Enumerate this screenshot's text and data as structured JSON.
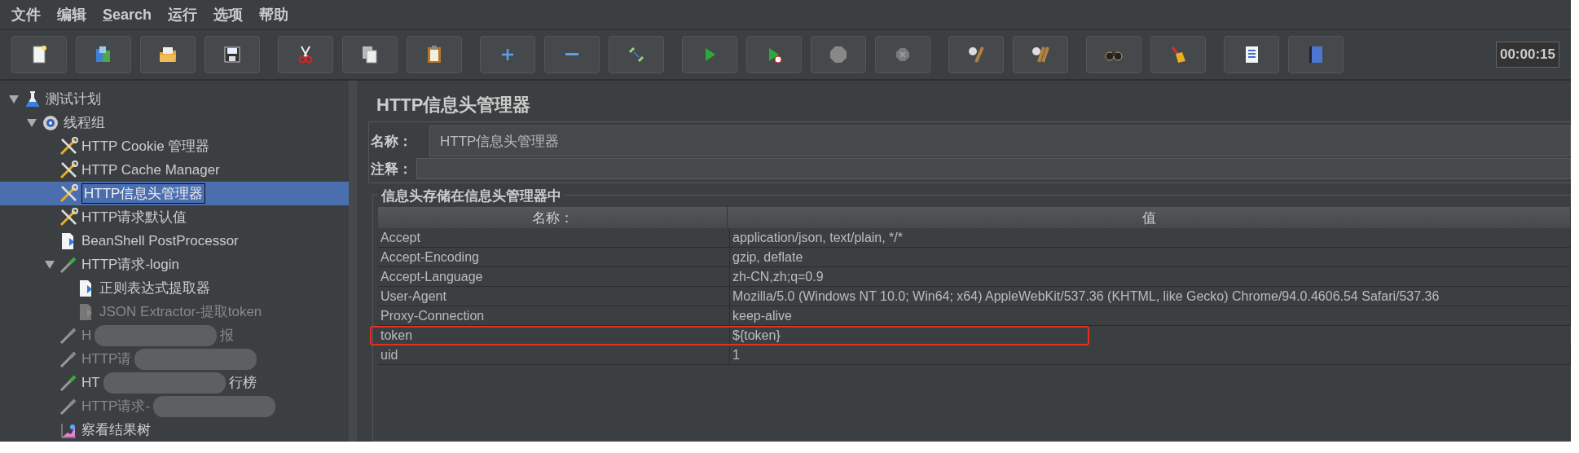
{
  "menu": [
    {
      "label": "文件"
    },
    {
      "label": "编辑"
    },
    {
      "label": "Search",
      "mnemonic": true
    },
    {
      "label": "运行"
    },
    {
      "label": "选项"
    },
    {
      "label": "帮助"
    }
  ],
  "toolbar": {
    "timer": "00:00:15"
  },
  "tree": [
    {
      "label": "测试计划",
      "kind": "plan",
      "expanded": true,
      "selected": false,
      "disabled": false,
      "children": [
        {
          "label": "线程组",
          "kind": "threads",
          "expanded": true,
          "selected": false,
          "disabled": false,
          "children": [
            {
              "label": "HTTP Cookie 管理器",
              "kind": "config",
              "selected": false,
              "disabled": false
            },
            {
              "label": "HTTP Cache Manager",
              "kind": "config",
              "selected": false,
              "disabled": false
            },
            {
              "label": "HTTP信息头管理器",
              "kind": "config",
              "selected": true,
              "disabled": false
            },
            {
              "label": "HTTP请求默认值",
              "kind": "config",
              "selected": false,
              "disabled": false
            },
            {
              "label": "BeanShell PostProcessor",
              "kind": "script",
              "selected": false,
              "disabled": false
            },
            {
              "label": "HTTP请求-login",
              "kind": "sampler",
              "expanded": true,
              "selected": false,
              "disabled": false,
              "children": [
                {
                  "label": "正则表达式提取器",
                  "kind": "script",
                  "selected": false,
                  "disabled": false
                },
                {
                  "label": "JSON Extractor-提取token",
                  "kind": "script",
                  "selected": false,
                  "disabled": true
                }
              ]
            },
            {
              "parts": [
                "H",
                "报"
              ],
              "kind": "sampler",
              "selected": false,
              "disabled": true
            },
            {
              "parts": [
                "HTTP请"
              ],
              "kind": "sampler",
              "selected": false,
              "disabled": true
            },
            {
              "parts": [
                "HT",
                "行榜"
              ],
              "kind": "sampler",
              "selected": false,
              "disabled": false
            },
            {
              "parts": [
                "HTTP请求-"
              ],
              "kind": "sampler",
              "selected": false,
              "disabled": true
            },
            {
              "label": "察看结果树",
              "kind": "listener",
              "selected": false,
              "disabled": false
            }
          ]
        }
      ]
    }
  ],
  "panel": {
    "title": "HTTP信息头管理器",
    "name_label": "名称：",
    "name_value": "HTTP信息头管理器",
    "comment_label": "注释：",
    "group_title": "信息头存储在信息头管理器中",
    "table": {
      "columns": [
        "名称：",
        "值"
      ],
      "rows": [
        {
          "name": "Accept",
          "value": "application/json, text/plain, */*",
          "highlighted": false
        },
        {
          "name": "Accept-Encoding",
          "value": "gzip, deflate",
          "highlighted": false
        },
        {
          "name": "Accept-Language",
          "value": "zh-CN,zh;q=0.9",
          "highlighted": false
        },
        {
          "name": "User-Agent",
          "value": "Mozilla/5.0 (Windows NT 10.0; Win64; x64) AppleWebKit/537.36 (KHTML, like Gecko) Chrome/94.0.4606.54 Safari/537.36",
          "highlighted": false
        },
        {
          "name": "Proxy-Connection",
          "value": "keep-alive",
          "highlighted": false
        },
        {
          "name": "token",
          "value": "${token}",
          "highlighted": true
        },
        {
          "name": "uid",
          "value": "1",
          "highlighted": false
        }
      ]
    }
  }
}
